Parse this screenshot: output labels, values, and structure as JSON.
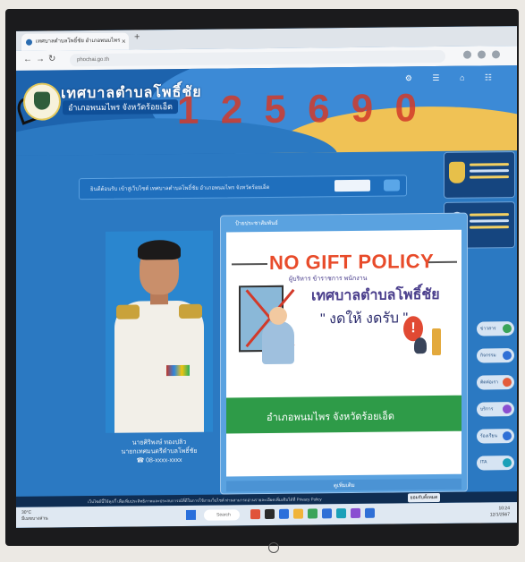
{
  "browser": {
    "tab_title": "เทศบาลตำบลโพธิ์ชัย อำเภอพนมไพร",
    "new_tab": "+",
    "tab_close": "×",
    "url": "phochai.go.th"
  },
  "header": {
    "site_title": "เทศบาลตำบลโพธิ์ชัย",
    "site_subtitle": "อำเภอพนมไพร จังหวัดร้อยเอ็ด",
    "banner": "1 2 5 6 9 0",
    "icons": "⚙ ☰ ⌂ ☷"
  },
  "search": {
    "text": "ยินดีต้อนรับ เข้าสู่เว็บไซต์ เทศบาลตำบลโพธิ์ชัย อำเภอพนมไพร จังหวัดร้อยเอ็ด",
    "placeholder": ""
  },
  "profile": {
    "name": "นายศิริพงษ์ ทองปลิว",
    "position": "นายกเทศมนตรีตำบลโพธิ์ชัย",
    "phone": "☎ 08-xxxx-xxxx"
  },
  "popup": {
    "title": "ป้ายประชาสัมพันธ์",
    "headline": "NO GIFT POLICY",
    "subtitle": "ผู้บริหาร ข้าราชการ พนักงาน",
    "org": "เทศบาลตำบลโพธิ์ชัย",
    "slogan": "\" งดให้ งดรับ \"",
    "alert": "!",
    "location": "อำเภอพนมไพร จังหวัดร้อยเอ็ด",
    "footer": "ดูเพิ่มเติม"
  },
  "side_menu": [
    {
      "label": "ข่าวสาร",
      "color": "#3aa45a"
    },
    {
      "label": "กิจกรรม",
      "color": "#2f6fd6"
    },
    {
      "label": "ติดต่อเรา",
      "color": "#e25b3a"
    },
    {
      "label": "บริการ",
      "color": "#8a4fd1"
    },
    {
      "label": "ร้องเรียน",
      "color": "#2f6fd6"
    },
    {
      "label": "ITA",
      "color": "#1aa0b8"
    }
  ],
  "cookie": {
    "text": "เว็บไซต์นี้ใช้คุกกี้ เพื่อเพิ่มประสิทธิภาพและประสบการณ์ที่ดีในการใช้งานเว็บไซต์ ท่านสามารถอ่านรายละเอียดเพิ่มเติมได้ที่ Privacy Policy",
    "accept": "ยอมรับทั้งหมด"
  },
  "taskbar": {
    "weather_temp": "30°C",
    "weather_text": "มีเมฆบางส่วน",
    "search": "Search",
    "time": "10:24",
    "date": "12/1/2567"
  },
  "colors": {
    "site_blue": "#2b79c2",
    "headline_red": "#e84b2a",
    "band_green": "#2e9b48"
  }
}
